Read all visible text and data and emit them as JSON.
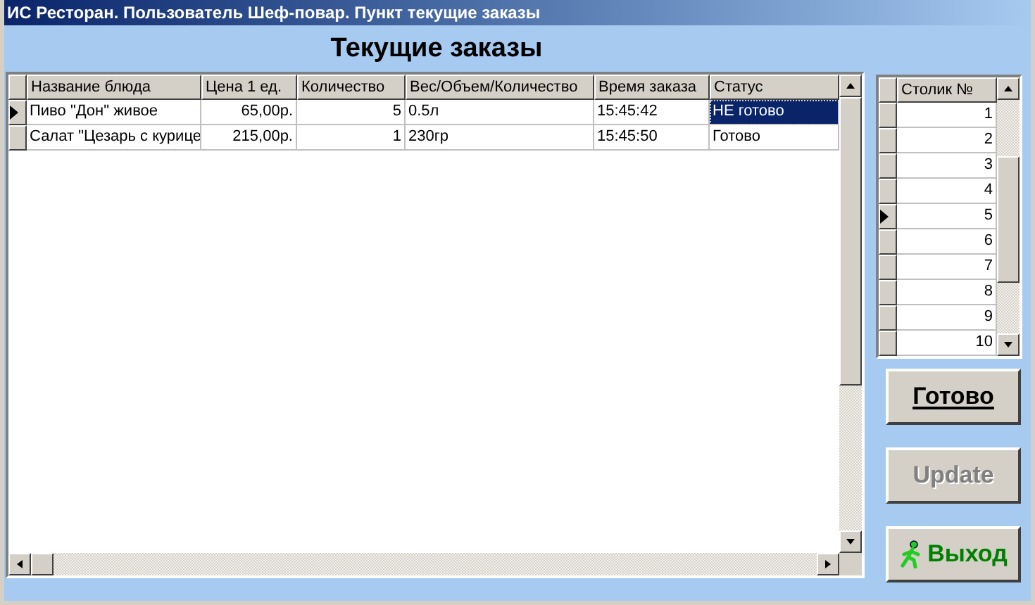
{
  "window": {
    "title": "ИС Ресторан. Пользователь Шеф-повар. Пункт текущие заказы"
  },
  "heading": "Текущие заказы",
  "orders": {
    "columns": [
      "Название блюда",
      "Цена 1 ед.",
      "Количество",
      "Вес/Объем/Количество",
      "Время заказа",
      "Статус"
    ],
    "rows": [
      {
        "current": true,
        "selected": true,
        "cells": [
          "Пиво \"Дон\" живое",
          "65,00р.",
          "5",
          "0.5л",
          "15:45:42",
          "НЕ готово"
        ]
      },
      {
        "current": false,
        "selected": false,
        "cells": [
          "Салат \"Цезарь с курице",
          "215,00р.",
          "1",
          "230гр",
          "15:45:50",
          "Готово"
        ]
      }
    ]
  },
  "tables": {
    "column": "Столик №",
    "rows": [
      {
        "number": "1",
        "current": false
      },
      {
        "number": "2",
        "current": false
      },
      {
        "number": "3",
        "current": false
      },
      {
        "number": "4",
        "current": false
      },
      {
        "number": "5",
        "current": true
      },
      {
        "number": "6",
        "current": false
      },
      {
        "number": "7",
        "current": false
      },
      {
        "number": "8",
        "current": false
      },
      {
        "number": "9",
        "current": false
      },
      {
        "number": "10",
        "current": false
      }
    ]
  },
  "buttons": [
    {
      "label": "Готово",
      "kind": "underlined",
      "disabled": false
    },
    {
      "label": "Update",
      "kind": "plain",
      "disabled": true
    },
    {
      "label": "Выход",
      "kind": "exit",
      "disabled": false
    }
  ]
}
